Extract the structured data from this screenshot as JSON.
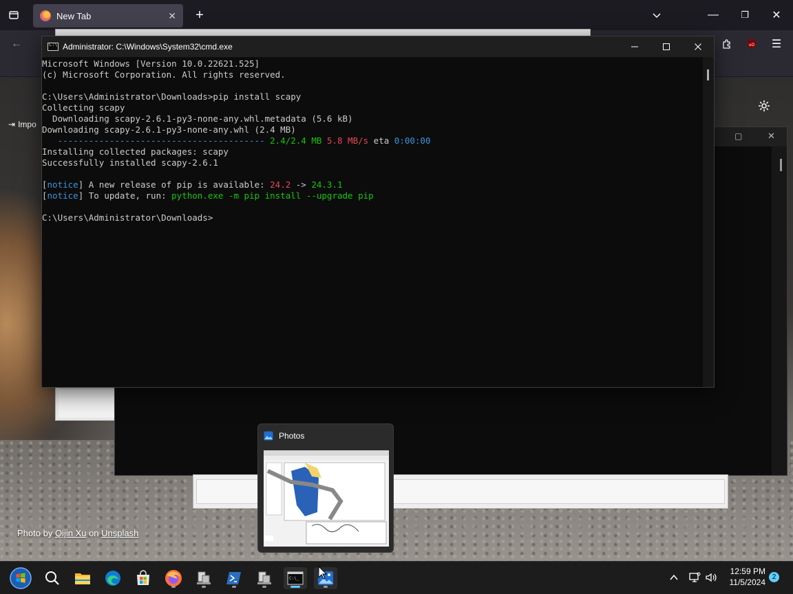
{
  "firefox": {
    "tab_title": "New Tab",
    "bookmark_import_label": "Impo"
  },
  "cmd": {
    "title": "Administrator: C:\\Windows\\System32\\cmd.exe",
    "lines": [
      {
        "segments": [
          {
            "text": "Microsoft Windows [Version 10.0.22621.525]",
            "color": "#cccccc"
          }
        ]
      },
      {
        "segments": [
          {
            "text": "(c) Microsoft Corporation. All rights reserved.",
            "color": "#cccccc"
          }
        ]
      },
      {
        "segments": [
          {
            "text": "",
            "color": "#cccccc"
          }
        ]
      },
      {
        "segments": [
          {
            "text": "C:\\Users\\Administrator\\Downloads>pip install scapy",
            "color": "#cccccc"
          }
        ]
      },
      {
        "segments": [
          {
            "text": "Collecting scapy",
            "color": "#cccccc"
          }
        ]
      },
      {
        "segments": [
          {
            "text": "  Downloading scapy-2.6.1-py3-none-any.whl.metadata (5.6 kB)",
            "color": "#cccccc"
          }
        ]
      },
      {
        "segments": [
          {
            "text": "Downloading scapy-2.6.1-py3-none-any.whl (2.4 MB)",
            "color": "#cccccc"
          }
        ]
      },
      {
        "segments": [
          {
            "text": "   ---------------------------------------- ",
            "color": "#3a96dd"
          },
          {
            "text": "2.4/2.4 MB",
            "color": "#16c60c"
          },
          {
            "text": " ",
            "color": "#cccccc"
          },
          {
            "text": "5.8 MB/s",
            "color": "#e74856"
          },
          {
            "text": " eta ",
            "color": "#cccccc"
          },
          {
            "text": "0:00:00",
            "color": "#3a96dd"
          }
        ]
      },
      {
        "segments": [
          {
            "text": "Installing collected packages: scapy",
            "color": "#cccccc"
          }
        ]
      },
      {
        "segments": [
          {
            "text": "Successfully installed scapy-2.6.1",
            "color": "#cccccc"
          }
        ]
      },
      {
        "segments": [
          {
            "text": "",
            "color": "#cccccc"
          }
        ]
      },
      {
        "segments": [
          {
            "text": "[",
            "color": "#cccccc"
          },
          {
            "text": "notice",
            "color": "#3a96dd"
          },
          {
            "text": "] A new release of pip is available: ",
            "color": "#cccccc"
          },
          {
            "text": "24.2",
            "color": "#e74856"
          },
          {
            "text": " -> ",
            "color": "#cccccc"
          },
          {
            "text": "24.3.1",
            "color": "#16c60c"
          }
        ]
      },
      {
        "segments": [
          {
            "text": "[",
            "color": "#cccccc"
          },
          {
            "text": "notice",
            "color": "#3a96dd"
          },
          {
            "text": "] To update, run: ",
            "color": "#cccccc"
          },
          {
            "text": "python.exe -m pip install --upgrade pip",
            "color": "#16c60c"
          }
        ]
      },
      {
        "segments": [
          {
            "text": "",
            "color": "#cccccc"
          }
        ]
      },
      {
        "segments": [
          {
            "text": "C:\\Users\\Administrator\\Downloads>",
            "color": "#cccccc"
          }
        ]
      }
    ]
  },
  "photos_popup": {
    "title": "Photos"
  },
  "credit": {
    "prefix": "Photo by ",
    "author": "Qijin Xu",
    "middle": " on ",
    "site": "Unsplash"
  },
  "taskbar": {
    "icons": [
      {
        "name": "start-button-icon"
      },
      {
        "name": "search-icon"
      },
      {
        "name": "file-explorer-icon"
      },
      {
        "name": "edge-icon"
      },
      {
        "name": "microsoft-store-icon"
      },
      {
        "name": "firefox-icon"
      },
      {
        "name": "network-app-icon"
      },
      {
        "name": "powershell-icon"
      },
      {
        "name": "network-app-2-icon"
      },
      {
        "name": "command-prompt-icon"
      },
      {
        "name": "photos-icon"
      }
    ],
    "time": "12:59 PM",
    "date": "11/5/2024",
    "notification_count": "2"
  },
  "colors": {
    "term_bg": "#0c0c0c",
    "accent": "#60cdff"
  }
}
